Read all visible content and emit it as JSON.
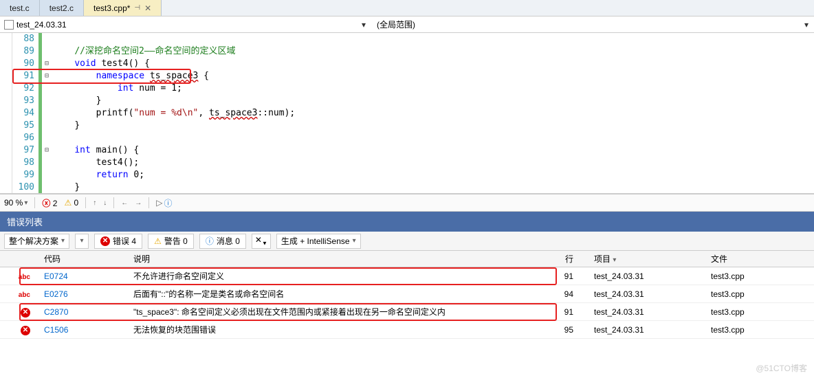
{
  "tabs": [
    "test.c",
    "test2.c",
    "test3.cpp*"
  ],
  "activeTab": 2,
  "nav": {
    "scope": "test_24.03.31",
    "right": "(全局范围)"
  },
  "code": {
    "start": 88,
    "lines": [
      {
        "n": 88,
        "i": 4,
        "tokens": []
      },
      {
        "n": 89,
        "i": 4,
        "fold": "",
        "tokens": [
          {
            "t": "//深挖命名空间2——命名空间的定义区域",
            "c": "c-green"
          }
        ]
      },
      {
        "n": 90,
        "i": 4,
        "fold": "⊟",
        "tokens": [
          {
            "t": "void",
            "c": "c-blue"
          },
          {
            "t": " test4() {",
            "c": "c-black"
          }
        ]
      },
      {
        "n": 91,
        "i": 8,
        "fold": "⊟",
        "tokens": [
          {
            "t": "namespace",
            "c": "c-blue"
          },
          {
            "t": " ",
            "c": ""
          },
          {
            "t": "ts_space3",
            "c": "c-black wavy"
          },
          {
            "t": " {",
            "c": "c-black"
          }
        ]
      },
      {
        "n": 92,
        "i": 12,
        "tokens": [
          {
            "t": "int",
            "c": "c-blue"
          },
          {
            "t": " num = 1;",
            "c": "c-black"
          }
        ]
      },
      {
        "n": 93,
        "i": 8,
        "tokens": [
          {
            "t": "}",
            "c": "c-black"
          }
        ]
      },
      {
        "n": 94,
        "i": 8,
        "tokens": [
          {
            "t": "printf(",
            "c": "c-black"
          },
          {
            "t": "\"num = %d\\n\"",
            "c": "c-brown"
          },
          {
            "t": ", ",
            "c": "c-black"
          },
          {
            "t": "ts_space3",
            "c": "c-black wavy"
          },
          {
            "t": "::num);",
            "c": "c-black"
          }
        ]
      },
      {
        "n": 95,
        "i": 4,
        "tokens": [
          {
            "t": "}",
            "c": "c-black"
          }
        ]
      },
      {
        "n": 96,
        "i": 0,
        "tokens": []
      },
      {
        "n": 97,
        "i": 4,
        "fold": "⊟",
        "tokens": [
          {
            "t": "int",
            "c": "c-blue"
          },
          {
            "t": " main() {",
            "c": "c-black"
          }
        ]
      },
      {
        "n": 98,
        "i": 8,
        "tokens": [
          {
            "t": "test4();",
            "c": "c-black"
          }
        ]
      },
      {
        "n": 99,
        "i": 8,
        "tokens": [
          {
            "t": "return",
            "c": "c-blue"
          },
          {
            "t": " 0;",
            "c": "c-black"
          }
        ]
      },
      {
        "n": 100,
        "i": 4,
        "tokens": [
          {
            "t": "}",
            "c": "c-black"
          }
        ]
      }
    ]
  },
  "zoom": {
    "pct": "90 %",
    "err": "2",
    "warn": "0"
  },
  "panel": {
    "title": "错误列表",
    "solution": "整个解决方案",
    "errLabel": "错误 4",
    "warnLabel": "警告 0",
    "infoLabel": "消息 0",
    "build": "生成 + IntelliSense",
    "headers": {
      "code": "代码",
      "desc": "说明",
      "line": "行",
      "proj": "项目",
      "file": "文件"
    },
    "rows": [
      {
        "icon": "abc",
        "code": "E0724",
        "desc": "不允许进行命名空间定义",
        "line": "91",
        "proj": "test_24.03.31",
        "file": "test3.cpp",
        "hl": true
      },
      {
        "icon": "abc",
        "code": "E0276",
        "desc": "后面有\"::\"的名称一定是类名或命名空间名",
        "line": "94",
        "proj": "test_24.03.31",
        "file": "test3.cpp"
      },
      {
        "icon": "x",
        "code": "C2870",
        "desc": "\"ts_space3\": 命名空间定义必须出现在文件范围内或紧接着出现在另一命名空间定义内",
        "line": "91",
        "proj": "test_24.03.31",
        "file": "test3.cpp",
        "hl": true
      },
      {
        "icon": "x",
        "code": "C1506",
        "desc": "无法恢复的块范围错误",
        "line": "95",
        "proj": "test_24.03.31",
        "file": "test3.cpp"
      }
    ]
  },
  "watermark": "@51CTO博客"
}
